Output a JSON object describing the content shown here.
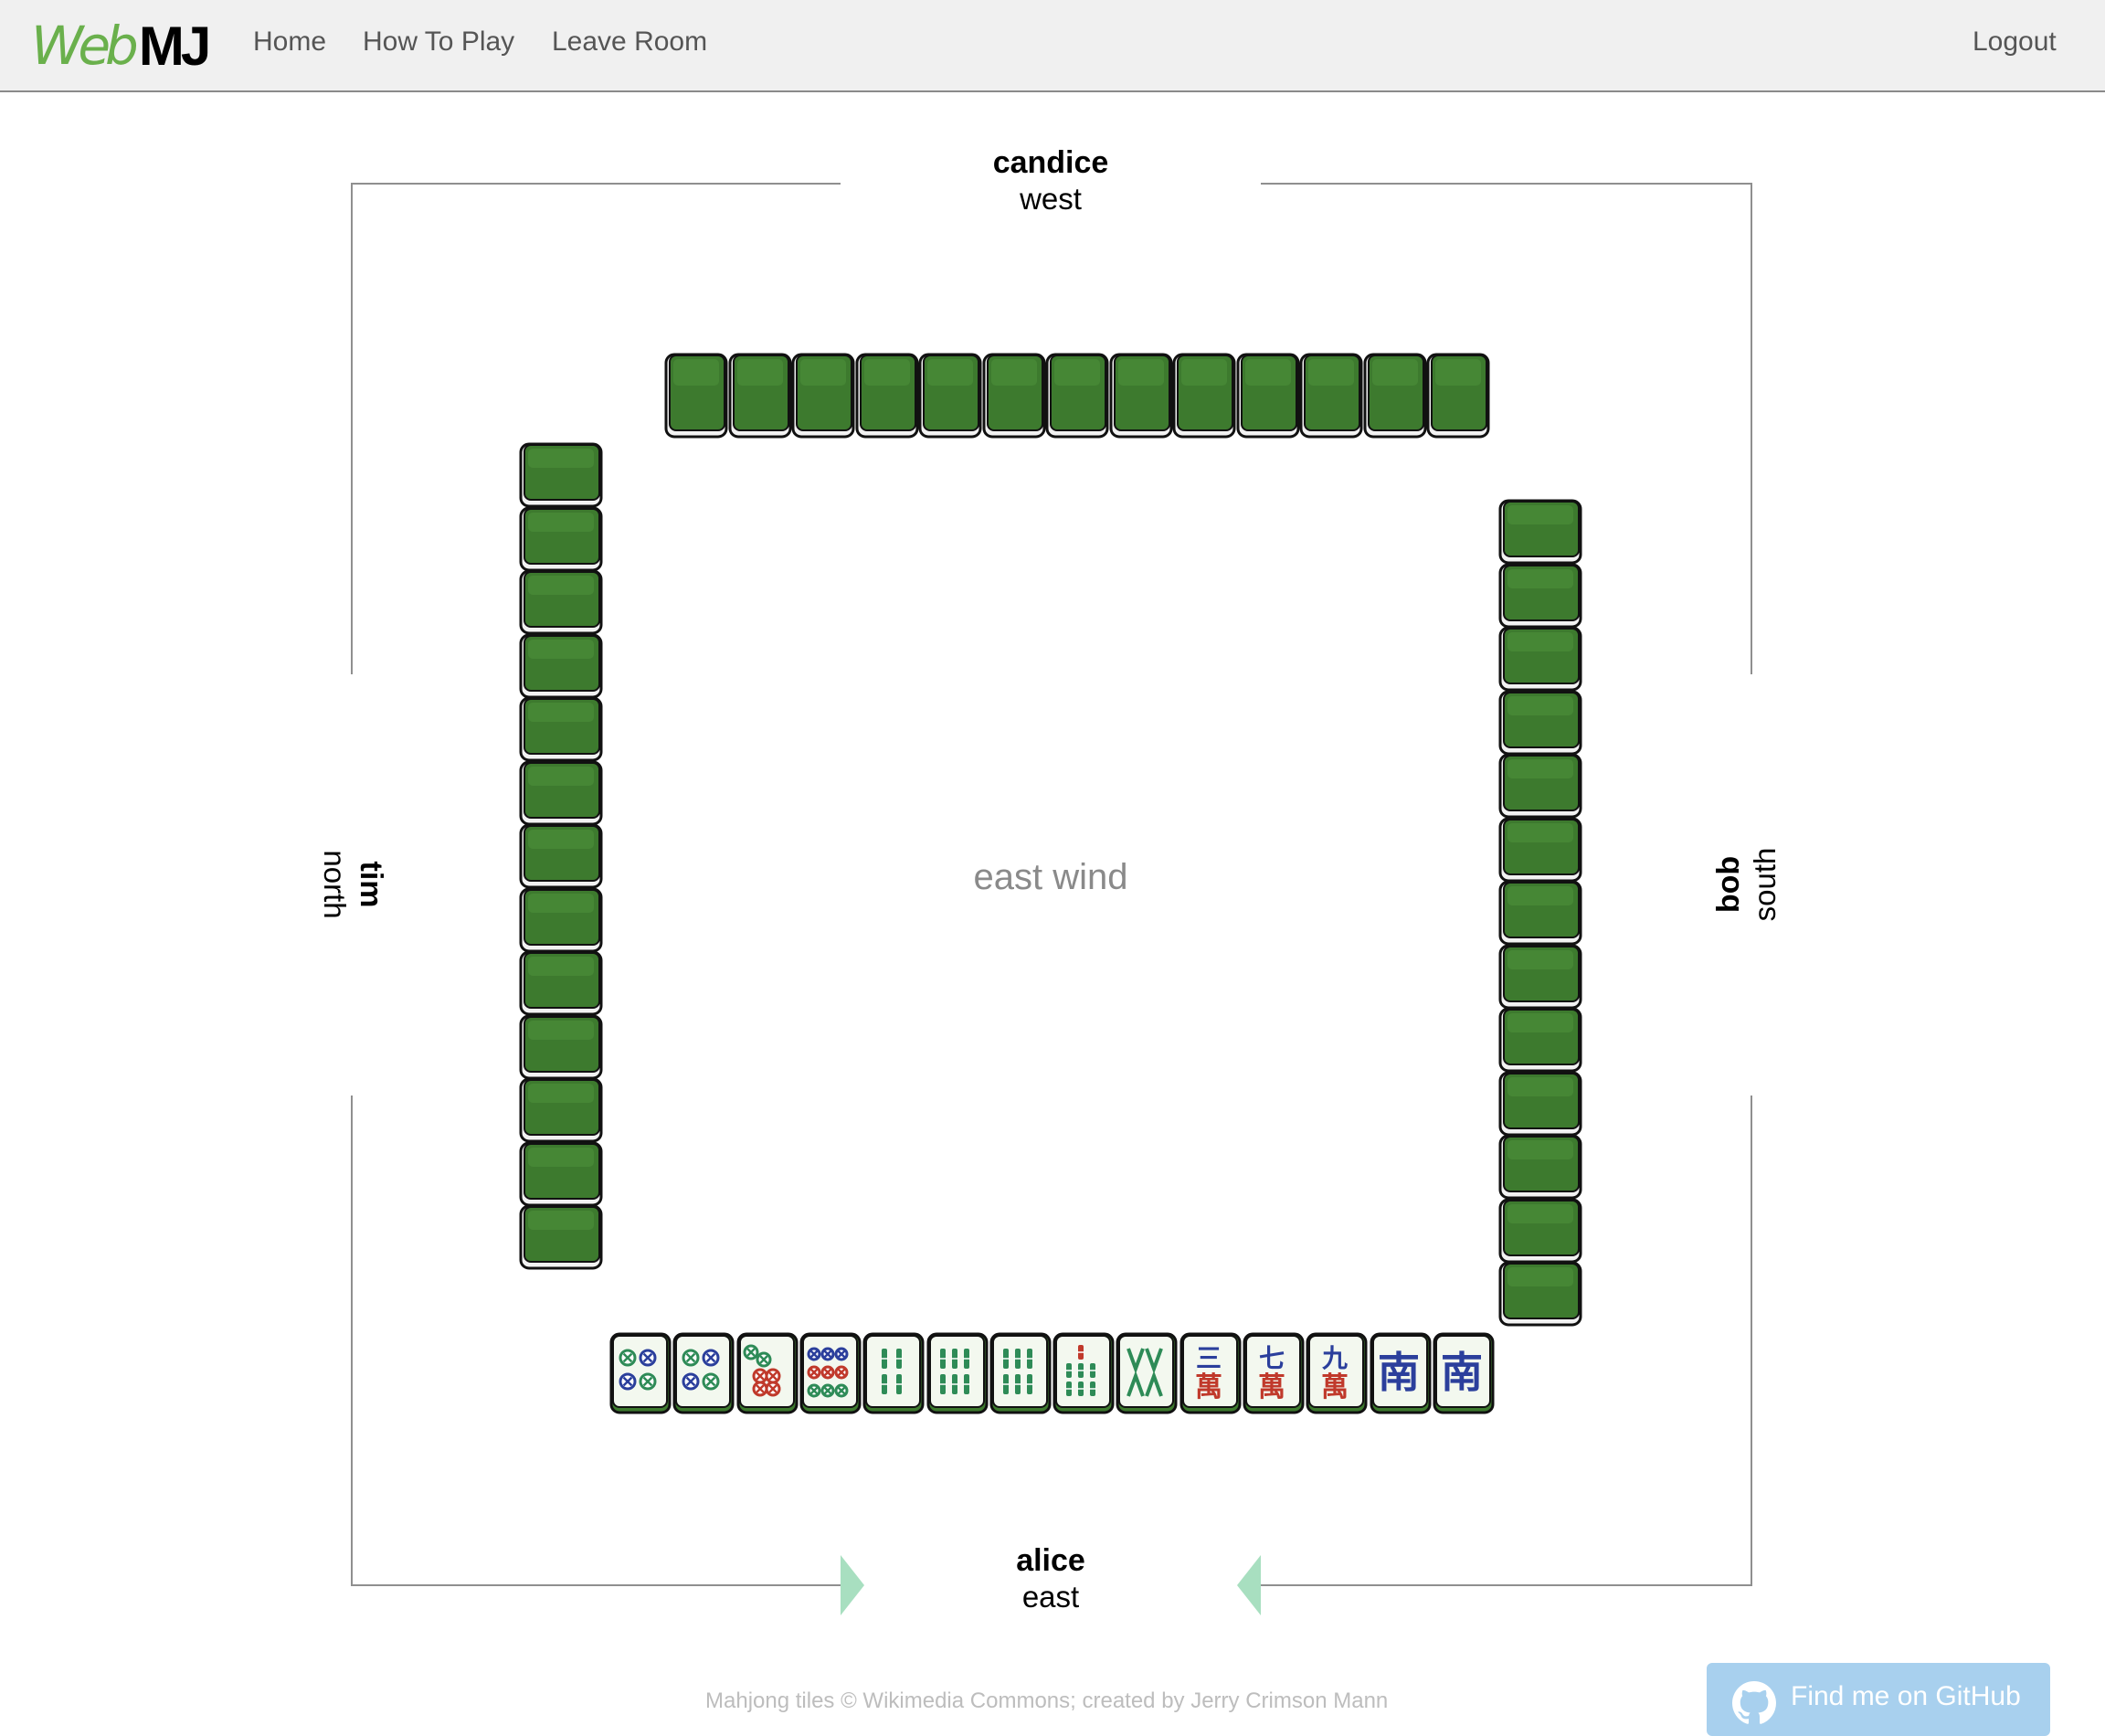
{
  "navbar": {
    "brand_web": "Web",
    "brand_mj": "MJ",
    "links": [
      "Home",
      "How To Play",
      "Leave Room"
    ],
    "logout": "Logout"
  },
  "table": {
    "round_wind": "east wind",
    "players": {
      "top": {
        "name": "candice",
        "wind": "west",
        "tiles_in_hand": 13
      },
      "right": {
        "name": "bob",
        "wind": "south",
        "tiles_in_hand": 13
      },
      "left": {
        "name": "tim",
        "wind": "north",
        "tiles_in_hand": 13
      },
      "bottom": {
        "name": "alice",
        "wind": "east",
        "tiles_in_hand": 14,
        "is_current_turn": true
      }
    },
    "my_hand": [
      "4 circles",
      "4 circles",
      "5 circles",
      "9 circles",
      "4 bamboo",
      "6 bamboo",
      "6 bamboo",
      "7 bamboo",
      "8 bamboo",
      "三萬",
      "七萬",
      "九萬",
      "南",
      "南"
    ]
  },
  "colors": {
    "tile_back": "#3d7a2e",
    "tile_face": "#f3f8ef",
    "circle_green": "#2e8b57",
    "circle_blue": "#2b3f9c",
    "circle_red": "#c0392b",
    "turn_arrow": "#a8dfc0",
    "brand_green": "#6ab04c",
    "github_button": "#a8d0ee"
  },
  "footer": {
    "credit": "Mahjong tiles © Wikimedia Commons; created by Jerry Crimson Mann",
    "github_label": "Find me on GitHub"
  }
}
